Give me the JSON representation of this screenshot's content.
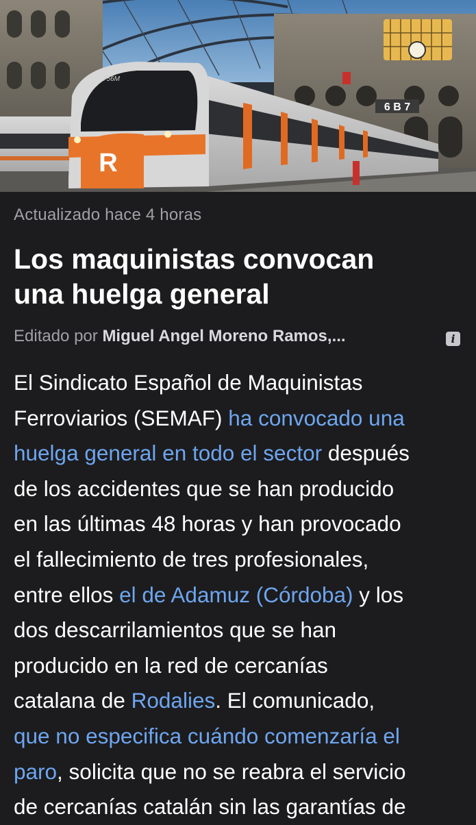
{
  "article": {
    "updated": "Actualizado hace 4 horas",
    "title_lines": [
      "Los maquinistas convocan",
      "una huelga general"
    ],
    "byline_prefix": "Editado por",
    "byline_author": "Miguel Angel Moreno Ramos,...",
    "hero_image": {
      "train_number": "756M",
      "train_logo": "R",
      "platform_sign": "6 B 7"
    },
    "body": {
      "l1": "El Sindicato Español de Maquinistas",
      "l2a": "Ferroviarios (SEMAF) ",
      "l2b": "ha convocado una",
      "l3a": "huelga general en todo el sector",
      "l3b": " después",
      "l4": "de los accidentes que se han producido",
      "l5": "en las últimas 48 horas y han provocado",
      "l6": "el fallecimiento de tres profesionales,",
      "l7a": "entre ellos ",
      "l7b": "el de Adamuz (Córdoba)",
      "l7c": " y los",
      "l8": "dos descarrilamientos que se han",
      "l9": "producido en la red de cercanías",
      "l10a": "catalana de ",
      "l10b": "Rodalies",
      "l10c": ". El comunicado,",
      "l11": "que no especifica cuándo comenzaría el",
      "l12a": "paro",
      "l12b": ", solicita que no se reabra el servicio",
      "l13": "de cercanías catalán sin las garantías de"
    }
  },
  "icons": {
    "info": "info-icon"
  },
  "colors": {
    "background": "#1c1c1e",
    "link": "#6ea6f0",
    "secondary_text": "#a1a1a6"
  }
}
